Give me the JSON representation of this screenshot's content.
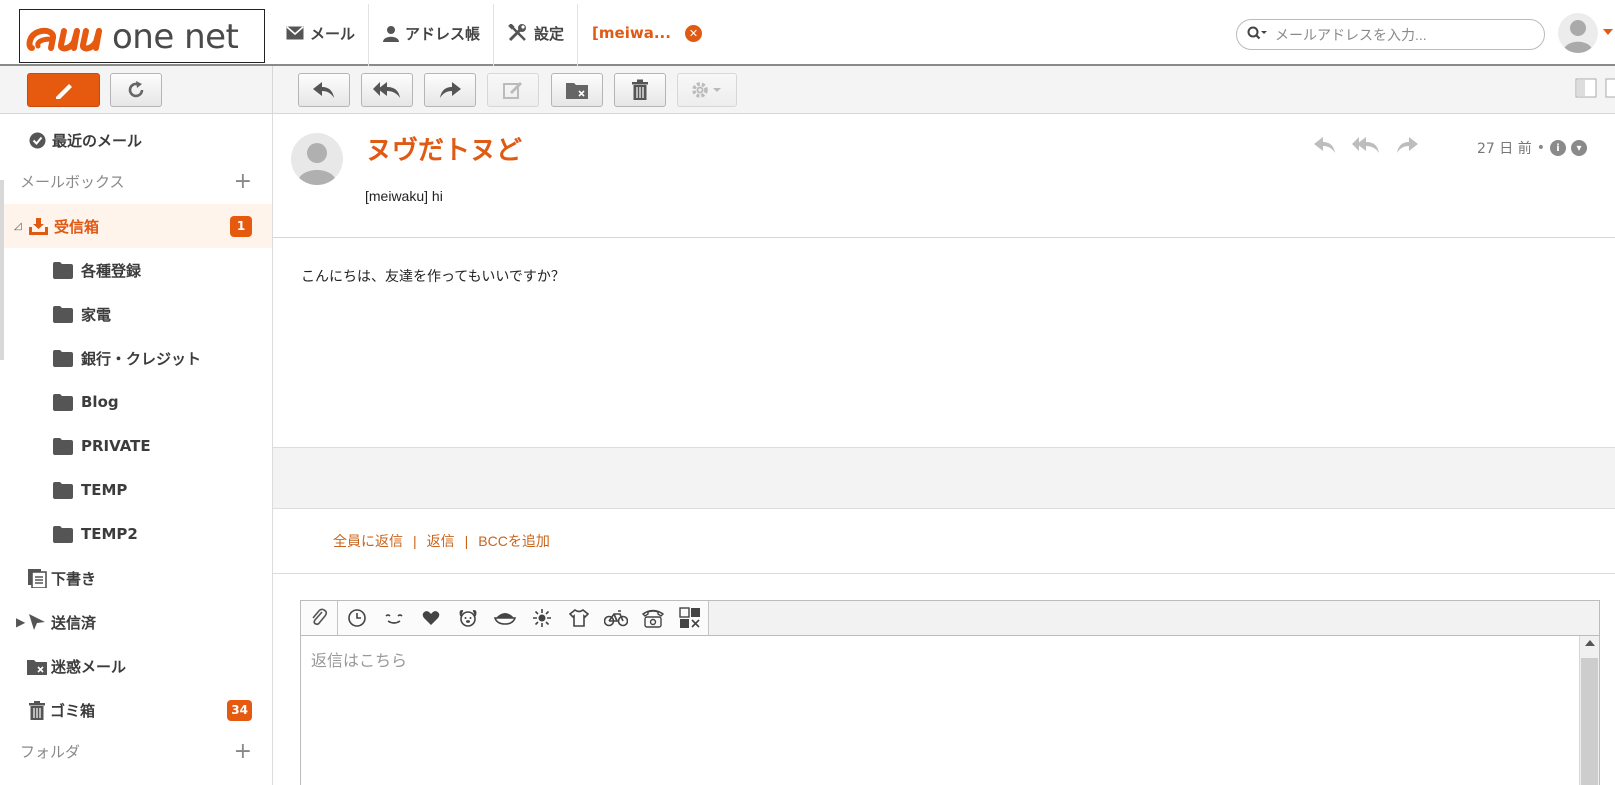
{
  "header": {
    "logo_brand": "one net",
    "nav": [
      {
        "label": "メール",
        "icon": "mail-icon"
      },
      {
        "label": "アドレス帳",
        "icon": "person-icon"
      },
      {
        "label": "設定",
        "icon": "tools-icon"
      },
      {
        "label": "[meiwa...",
        "icon": "close-icon"
      }
    ],
    "search_placeholder": "メールアドレスを入力..."
  },
  "sidebar": {
    "recent": "最近のメール",
    "mailbox_section": "メールボックス",
    "inbox": {
      "label": "受信箱",
      "badge": "1"
    },
    "subfolders": [
      "各種登録",
      "家電",
      "銀行・クレジット",
      "Blog",
      "PRIVATE",
      "TEMP",
      "TEMP2"
    ],
    "drafts": "下書き",
    "sent": "送信済",
    "spam": "迷惑メール",
    "trash": {
      "label": "ゴミ箱",
      "badge": "34"
    },
    "folder_section": "フォルダ"
  },
  "message": {
    "sender": "ヌヴだトヌど",
    "subject": "[meiwaku] hi",
    "date": "27 日 前",
    "body": "こんにちは、友達を作ってもいいですか？"
  },
  "reply": {
    "reply_all": "全員に返信",
    "reply": "返信",
    "add_bcc": "BCCを追加",
    "separator": "|",
    "compose_placeholder": "返信はこちら"
  },
  "colors": {
    "accent": "#e05a14",
    "accent_button": "#e65a10",
    "link": "#c8641a"
  }
}
